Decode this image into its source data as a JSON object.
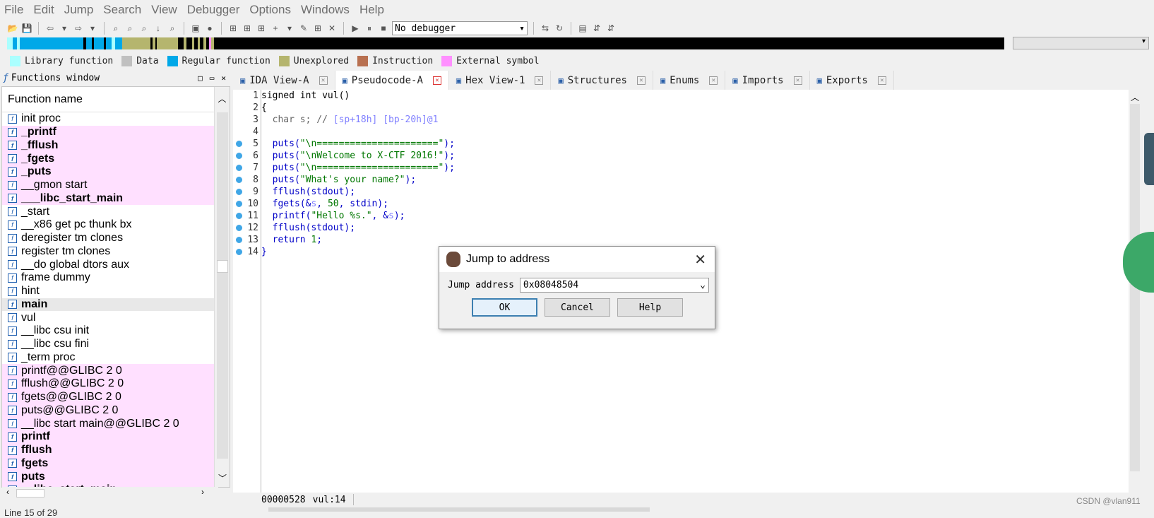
{
  "menu": [
    "File",
    "Edit",
    "Jump",
    "Search",
    "View",
    "Debugger",
    "Options",
    "Windows",
    "Help"
  ],
  "toolbar": {
    "debugger_select": "No debugger"
  },
  "legend": [
    {
      "label": "Library function",
      "color": "#aaffff"
    },
    {
      "label": "Data",
      "color": "#c0c0c0"
    },
    {
      "label": "Regular function",
      "color": "#00a8e8"
    },
    {
      "label": "Unexplored",
      "color": "#b5b56e"
    },
    {
      "label": "Instruction",
      "color": "#b87050"
    },
    {
      "label": "External symbol",
      "color": "#ff90ff"
    }
  ],
  "functions_window": {
    "title": "Functions window",
    "header": "Function name",
    "items": [
      {
        "name": "init proc",
        "style": "normal"
      },
      {
        "name": "_printf",
        "style": "pink-bold"
      },
      {
        "name": "_fflush",
        "style": "pink-bold"
      },
      {
        "name": "_fgets",
        "style": "pink-bold"
      },
      {
        "name": "_puts",
        "style": "pink-bold"
      },
      {
        "name": "__gmon start",
        "style": "pink"
      },
      {
        "name": "___libc_start_main",
        "style": "pink-bold"
      },
      {
        "name": "_start",
        "style": "normal"
      },
      {
        "name": "__x86 get pc thunk bx",
        "style": "normal"
      },
      {
        "name": "deregister tm clones",
        "style": "normal"
      },
      {
        "name": "register tm clones",
        "style": "normal"
      },
      {
        "name": "__do global dtors aux",
        "style": "normal"
      },
      {
        "name": "frame dummy",
        "style": "normal"
      },
      {
        "name": "hint",
        "style": "normal"
      },
      {
        "name": "main",
        "style": "selected-bold"
      },
      {
        "name": "vul",
        "style": "normal"
      },
      {
        "name": "__libc csu init",
        "style": "normal"
      },
      {
        "name": "__libc csu fini",
        "style": "normal"
      },
      {
        "name": "_term proc",
        "style": "normal"
      },
      {
        "name": "printf@@GLIBC 2 0",
        "style": "pink"
      },
      {
        "name": "fflush@@GLIBC 2 0",
        "style": "pink"
      },
      {
        "name": "fgets@@GLIBC 2 0",
        "style": "pink"
      },
      {
        "name": "puts@@GLIBC 2 0",
        "style": "pink"
      },
      {
        "name": "__libc start main@@GLIBC 2 0",
        "style": "pink"
      },
      {
        "name": "printf",
        "style": "pink-bold"
      },
      {
        "name": "fflush",
        "style": "pink-bold"
      },
      {
        "name": "fgets",
        "style": "pink-bold"
      },
      {
        "name": "puts",
        "style": "pink-bold"
      },
      {
        "name": "__libc_start_main",
        "style": "pink-bold"
      }
    ],
    "line_status": "Line 15 of 29"
  },
  "tabs": [
    {
      "label": "IDA View-A",
      "icon": "ida-view-icon",
      "active": false
    },
    {
      "label": "Pseudocode-A",
      "icon": "pseudocode-icon",
      "active": true
    },
    {
      "label": "Hex View-1",
      "icon": "hex-view-icon",
      "active": false
    },
    {
      "label": "Structures",
      "icon": "structures-icon",
      "active": false
    },
    {
      "label": "Enums",
      "icon": "enums-icon",
      "active": false
    },
    {
      "label": "Imports",
      "icon": "imports-icon",
      "active": false
    },
    {
      "label": "Exports",
      "icon": "exports-icon",
      "active": false
    }
  ],
  "code": [
    {
      "n": "1",
      "bp": false,
      "parts": [
        [
          "",
          "signed int vul()"
        ]
      ]
    },
    {
      "n": "2",
      "bp": false,
      "parts": [
        [
          "",
          "{"
        ]
      ]
    },
    {
      "n": "3",
      "bp": false,
      "parts": [
        [
          "gry",
          "  char s; // "
        ],
        [
          "purp",
          "[sp+18h] [bp-20h]@1"
        ]
      ]
    },
    {
      "n": "4",
      "bp": false,
      "parts": [
        [
          "",
          ""
        ]
      ]
    },
    {
      "n": "5",
      "bp": true,
      "parts": [
        [
          "blue",
          "  puts("
        ],
        [
          "grn",
          "\"\\n======================\""
        ],
        [
          "blue",
          ");"
        ]
      ]
    },
    {
      "n": "6",
      "bp": true,
      "parts": [
        [
          "blue",
          "  puts("
        ],
        [
          "grn",
          "\"\\nWelcome to X-CTF 2016!\""
        ],
        [
          "blue",
          ");"
        ]
      ]
    },
    {
      "n": "7",
      "bp": true,
      "parts": [
        [
          "blue",
          "  puts("
        ],
        [
          "grn",
          "\"\\n======================\""
        ],
        [
          "blue",
          ");"
        ]
      ]
    },
    {
      "n": "8",
      "bp": true,
      "parts": [
        [
          "blue",
          "  puts("
        ],
        [
          "grn",
          "\"What's your name?\""
        ],
        [
          "blue",
          ");"
        ]
      ]
    },
    {
      "n": "9",
      "bp": true,
      "parts": [
        [
          "blue",
          "  fflush(stdout);"
        ]
      ]
    },
    {
      "n": "10",
      "bp": true,
      "parts": [
        [
          "blue",
          "  fgets(&"
        ],
        [
          "purp",
          "s"
        ],
        [
          "blue",
          ", "
        ],
        [
          "grn",
          "50"
        ],
        [
          "blue",
          ", stdin);"
        ]
      ]
    },
    {
      "n": "11",
      "bp": true,
      "parts": [
        [
          "blue",
          "  printf("
        ],
        [
          "grn",
          "\"Hello %s.\""
        ],
        [
          "blue",
          ", &"
        ],
        [
          "purp",
          "s"
        ],
        [
          "blue",
          ");"
        ]
      ]
    },
    {
      "n": "12",
      "bp": true,
      "parts": [
        [
          "blue",
          "  fflush(stdout);"
        ]
      ]
    },
    {
      "n": "13",
      "bp": true,
      "parts": [
        [
          "blue",
          "  return "
        ],
        [
          "grn",
          "1"
        ],
        [
          "blue",
          ";"
        ]
      ]
    },
    {
      "n": "14",
      "bp": true,
      "parts": [
        [
          "blue",
          "}"
        ]
      ]
    }
  ],
  "status": {
    "address": "00000528",
    "location": "vul:14"
  },
  "dialog": {
    "title": "Jump to address",
    "label": "Jump address",
    "value": "0x08048504",
    "ok": "OK",
    "cancel": "Cancel",
    "help": "Help"
  },
  "watermark": "CSDN @vlan911"
}
